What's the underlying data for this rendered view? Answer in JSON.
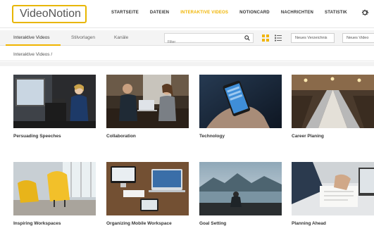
{
  "app": {
    "logo_text": "VideoNotion"
  },
  "nav": {
    "items": [
      {
        "label": "STARTSEITE",
        "active": false
      },
      {
        "label": "DATEIEN",
        "active": false
      },
      {
        "label": "INTERAKTIVE VIDEOS",
        "active": true
      },
      {
        "label": "NOTIONCARD",
        "active": false
      },
      {
        "label": "NACHRICHTEN",
        "active": false
      },
      {
        "label": "STATISTIK",
        "active": false
      }
    ],
    "settings_icon": "gear-icon"
  },
  "subnav": {
    "tabs": [
      {
        "label": "Interaktive Videos",
        "active": true
      },
      {
        "label": "Stilvorlagen",
        "active": false
      },
      {
        "label": "Kanäle",
        "active": false
      }
    ],
    "search": {
      "placeholder": "Filter",
      "value": "",
      "icon": "search-icon"
    },
    "view_grid_icon": "grid-view-icon",
    "view_list_icon": "list-view-icon",
    "new_folder_label": "Neues Verzeichnis",
    "new_video_label": "Neues Video"
  },
  "breadcrumb": {
    "text": "Interaktive Videos /"
  },
  "videos": [
    {
      "title": "Persuading Speeches"
    },
    {
      "title": "Collaboration"
    },
    {
      "title": "Technology"
    },
    {
      "title": "Career Planing"
    },
    {
      "title": "Inspiring Workspaces"
    },
    {
      "title": "Organizing Mobile Workspace"
    },
    {
      "title": "Goal Setting"
    },
    {
      "title": "Planning Ahead"
    }
  ],
  "colors": {
    "accent": "#f0b400",
    "text": "#333333",
    "border": "#d0d0d0"
  }
}
